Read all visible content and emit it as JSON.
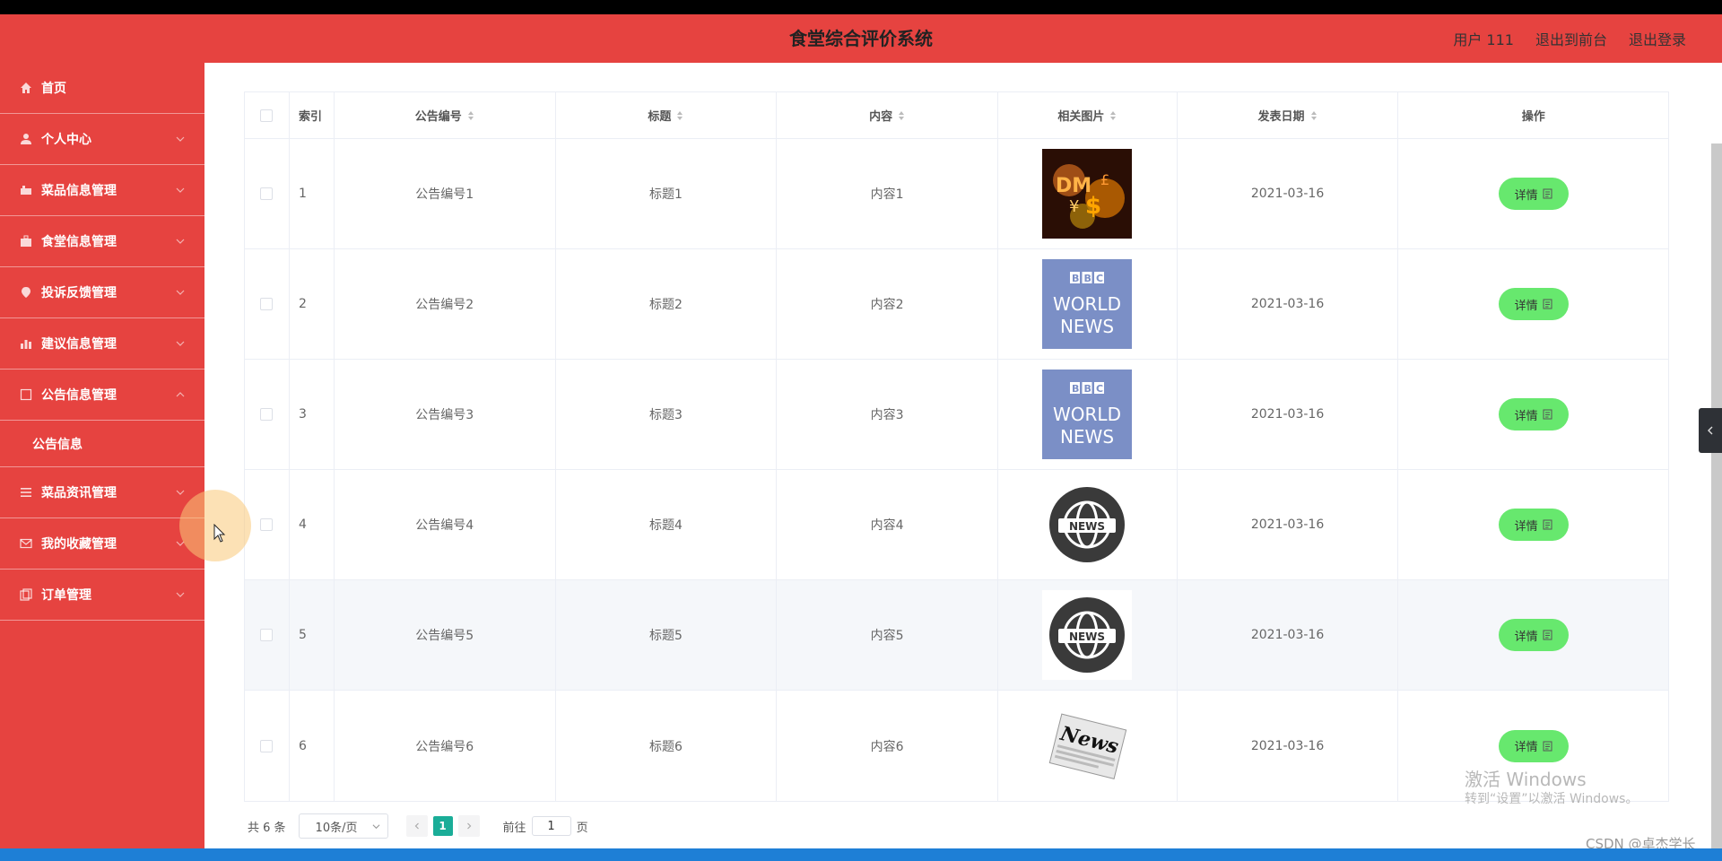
{
  "header": {
    "title": "食堂综合评价系统",
    "user": "用户 111",
    "back_front": "退出到前台",
    "logout": "退出登录"
  },
  "sidebar": {
    "items": [
      {
        "label": "首页",
        "icon": "home-icon"
      },
      {
        "label": "个人中心",
        "icon": "user-icon"
      },
      {
        "label": "菜品信息管理",
        "icon": "dish-icon"
      },
      {
        "label": "食堂信息管理",
        "icon": "briefcase-icon"
      },
      {
        "label": "投诉反馈管理",
        "icon": "location-icon"
      },
      {
        "label": "建议信息管理",
        "icon": "chart-icon"
      },
      {
        "label": "公告信息管理",
        "icon": "square-icon"
      },
      {
        "label": "菜品资讯管理",
        "icon": "list-icon"
      },
      {
        "label": "我的收藏管理",
        "icon": "mail-icon"
      },
      {
        "label": "订单管理",
        "icon": "copy-icon"
      }
    ],
    "sub_item": "公告信息"
  },
  "table": {
    "headers": {
      "index": "索引",
      "number": "公告编号",
      "title": "标题",
      "content": "内容",
      "image": "相关图片",
      "date": "发表日期",
      "op": "操作"
    },
    "rows": [
      {
        "idx": "1",
        "number": "公告编号1",
        "title": "标题1",
        "content": "内容1",
        "image": "money-image",
        "date": "2021-03-16"
      },
      {
        "idx": "2",
        "number": "公告编号2",
        "title": "标题2",
        "content": "内容2",
        "image": "bbc-image",
        "date": "2021-03-16"
      },
      {
        "idx": "3",
        "number": "公告编号3",
        "title": "标题3",
        "content": "内容3",
        "image": "bbc-image",
        "date": "2021-03-16"
      },
      {
        "idx": "4",
        "number": "公告编号4",
        "title": "标题4",
        "content": "内容4",
        "image": "globe-news-image",
        "date": "2021-03-16"
      },
      {
        "idx": "5",
        "number": "公告编号5",
        "title": "标题5",
        "content": "内容5",
        "image": "globe-news-image",
        "date": "2021-03-16"
      },
      {
        "idx": "6",
        "number": "公告编号6",
        "title": "标题6",
        "content": "内容6",
        "image": "newspaper-image",
        "date": "2021-03-16"
      }
    ],
    "detail_label": "详情"
  },
  "pager": {
    "total": "共 6 条",
    "page_size": "10条/页",
    "current": "1",
    "goto": "前往",
    "goto_value": "1",
    "page_unit": "页"
  },
  "watermark": {
    "line1": "激活 Windows",
    "line2": "转到“设置”以激活 Windows。"
  },
  "csdn": "CSDN @卓杰学长",
  "colors": {
    "primary": "#e64340",
    "detail_button": "#67e86e",
    "page_active": "#1aad98"
  }
}
